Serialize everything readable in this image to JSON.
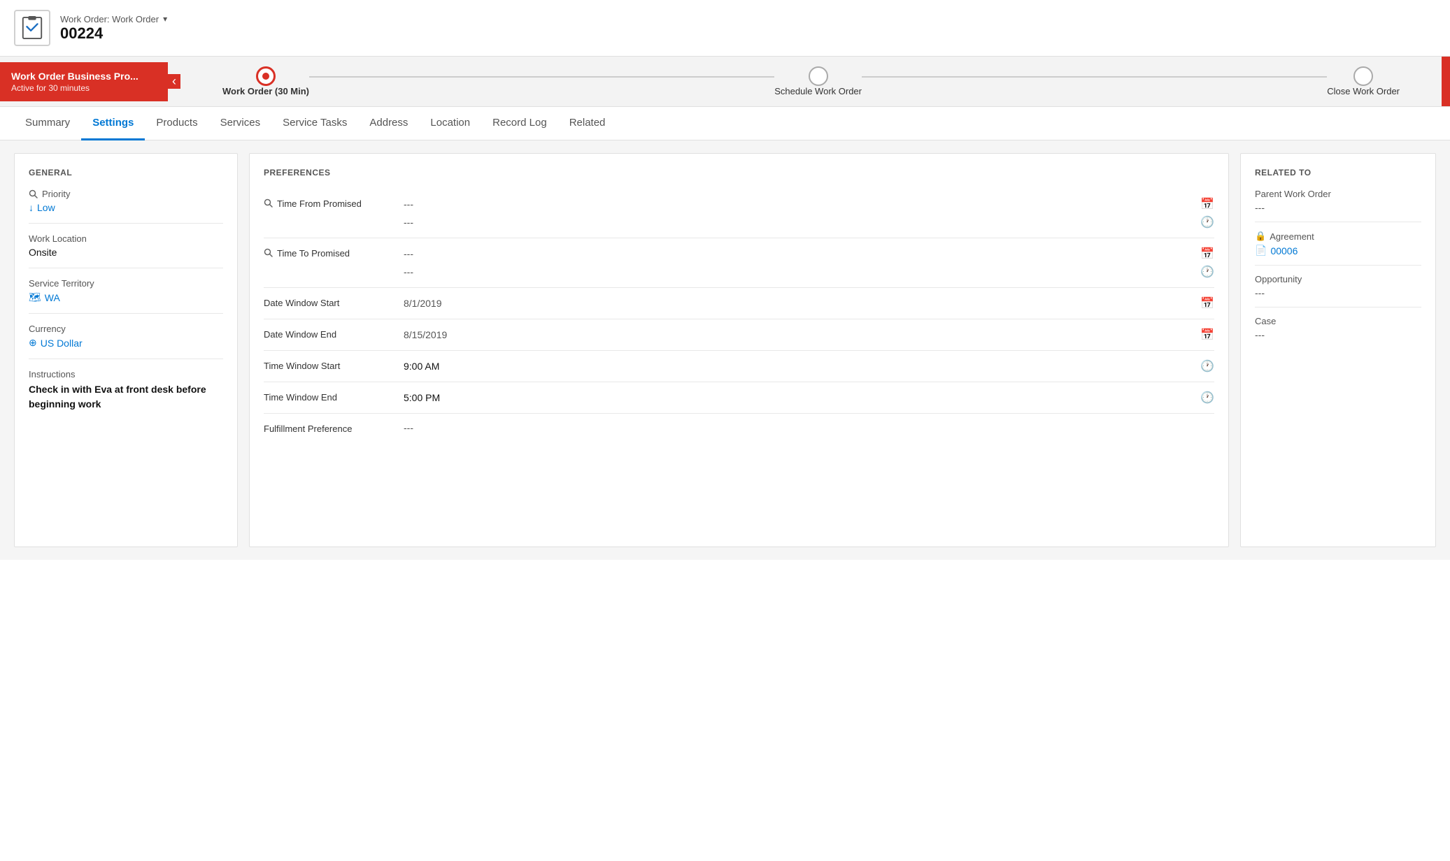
{
  "header": {
    "subtitle": "Work Order: Work Order",
    "main_title": "00224",
    "chevron": "▾"
  },
  "process_bar": {
    "left_title": "Work Order Business Pro...",
    "left_sub": "Active for 30 minutes",
    "arrow_label": "‹",
    "steps": [
      {
        "id": "step-work-order",
        "label": "Work Order (30 Min)",
        "active": true
      },
      {
        "id": "step-schedule",
        "label": "Schedule Work Order",
        "active": false
      },
      {
        "id": "step-close",
        "label": "Close Work Order",
        "active": false
      }
    ]
  },
  "tabs": [
    {
      "id": "tab-summary",
      "label": "Summary",
      "active": false
    },
    {
      "id": "tab-settings",
      "label": "Settings",
      "active": true
    },
    {
      "id": "tab-products",
      "label": "Products",
      "active": false
    },
    {
      "id": "tab-services",
      "label": "Services",
      "active": false
    },
    {
      "id": "tab-service-tasks",
      "label": "Service Tasks",
      "active": false
    },
    {
      "id": "tab-address",
      "label": "Address",
      "active": false
    },
    {
      "id": "tab-location",
      "label": "Location",
      "active": false
    },
    {
      "id": "tab-record-log",
      "label": "Record Log",
      "active": false
    },
    {
      "id": "tab-related",
      "label": "Related",
      "active": false
    }
  ],
  "general": {
    "section_title": "GENERAL",
    "priority_label": "Priority",
    "priority_value": "Low",
    "work_location_label": "Work Location",
    "work_location_value": "Onsite",
    "service_territory_label": "Service Territory",
    "service_territory_value": "WA",
    "currency_label": "Currency",
    "currency_value": "US Dollar",
    "instructions_label": "Instructions",
    "instructions_value": "Check in with Eva at front desk before beginning work"
  },
  "preferences": {
    "section_title": "PREFERENCES",
    "fields": [
      {
        "id": "time-from-promised",
        "label": "Time From Promised",
        "has_icon": true,
        "value1": "---",
        "value2": "---",
        "icon1": "calendar",
        "icon2": "clock"
      },
      {
        "id": "time-to-promised",
        "label": "Time To Promised",
        "has_icon": true,
        "value1": "---",
        "value2": "---",
        "icon1": "calendar",
        "icon2": "clock"
      },
      {
        "id": "date-window-start",
        "label": "Date Window Start",
        "has_icon": false,
        "value1": "8/1/2019",
        "icon1": "calendar"
      },
      {
        "id": "date-window-end",
        "label": "Date Window End",
        "has_icon": false,
        "value1": "8/15/2019",
        "icon1": "calendar"
      },
      {
        "id": "time-window-start",
        "label": "Time Window Start",
        "has_icon": false,
        "value1": "9:00 AM",
        "icon1": "clock"
      },
      {
        "id": "time-window-end",
        "label": "Time Window End",
        "has_icon": false,
        "value1": "5:00 PM",
        "icon1": "clock"
      },
      {
        "id": "fulfillment-preference",
        "label": "Fulfillment Preference",
        "has_icon": false,
        "value1": "---",
        "icon1": "none"
      }
    ]
  },
  "related_to": {
    "section_title": "RELATED TO",
    "parent_work_order_label": "Parent Work Order",
    "parent_work_order_value": "---",
    "agreement_label": "Agreement",
    "agreement_value": "00006",
    "opportunity_label": "Opportunity",
    "opportunity_value": "---",
    "case_label": "Case",
    "case_value": "---"
  }
}
